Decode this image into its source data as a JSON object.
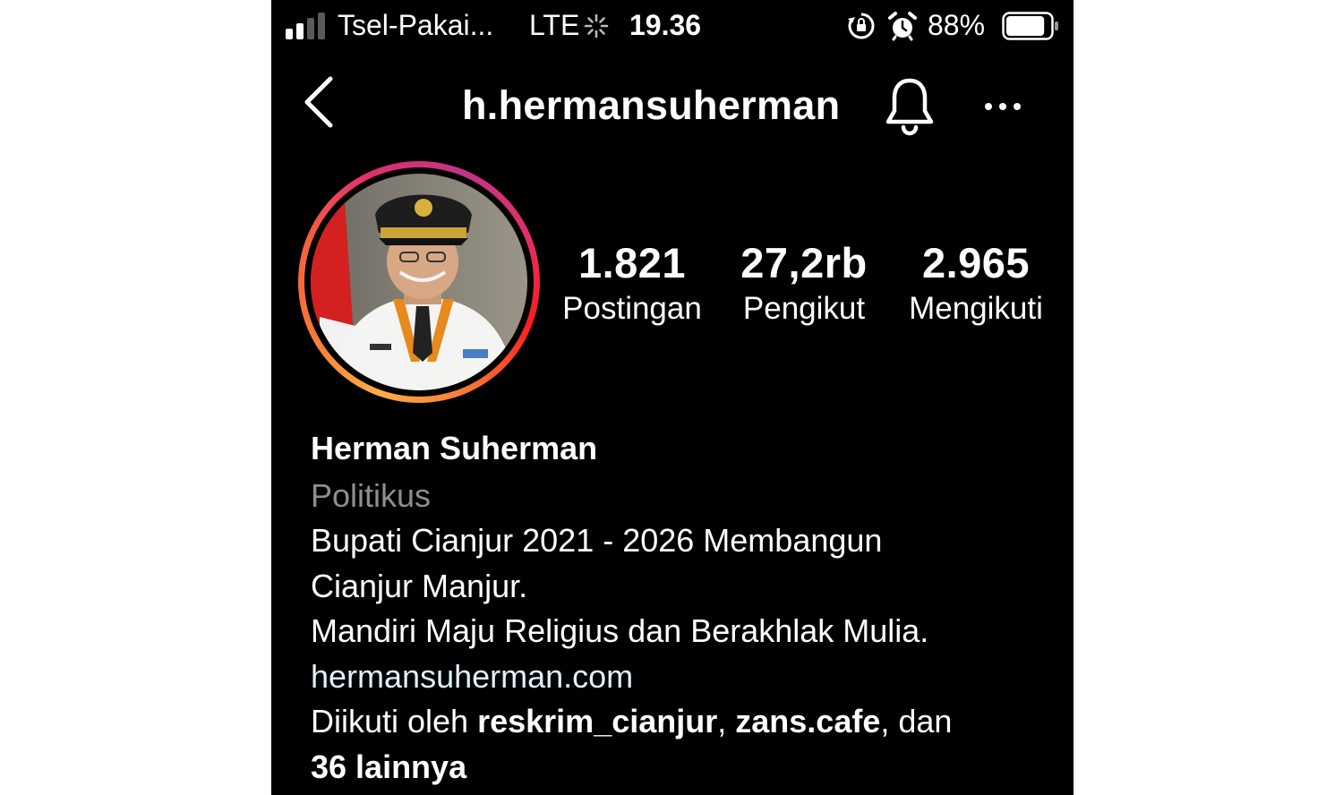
{
  "status_bar": {
    "carrier": "Tsel-Pakai...",
    "network": "LTE",
    "time": "19.36",
    "battery_percent": "88%",
    "battery_level": 0.88,
    "signal_bars_active": 2,
    "signal_bars_total": 4
  },
  "header": {
    "username": "h.hermansuherman",
    "icons": [
      "back-chevron-icon",
      "bell-icon",
      "more-icon"
    ]
  },
  "stats": {
    "posts": {
      "count": "1.821",
      "label": "Postingan"
    },
    "followers": {
      "count": "27,2rb",
      "label": "Pengikut"
    },
    "following": {
      "count": "2.965",
      "label": "Mengikuti"
    }
  },
  "bio": {
    "name": "Herman Suherman",
    "category": "Politikus",
    "lines": [
      "Bupati Cianjur 2021 - 2026 Membangun",
      "Cianjur Manjur.",
      "Mandiri Maju Religius dan Berakhlak Mulia."
    ],
    "link": "hermansuherman.com",
    "followed_by": {
      "prefix": "Diikuti oleh ",
      "user1": "reskrim_cianjur",
      "sep": ", ",
      "user2": "zans.cafe",
      "conj": ", dan",
      "others": "36 lainnya"
    }
  },
  "colors": {
    "background": "#000000",
    "text": "#ffffff",
    "muted": "#8e8e8e",
    "link": "#e0f1ff",
    "story_ring": [
      "#fcaf45",
      "#f77737",
      "#e1306c",
      "#c13584"
    ]
  }
}
